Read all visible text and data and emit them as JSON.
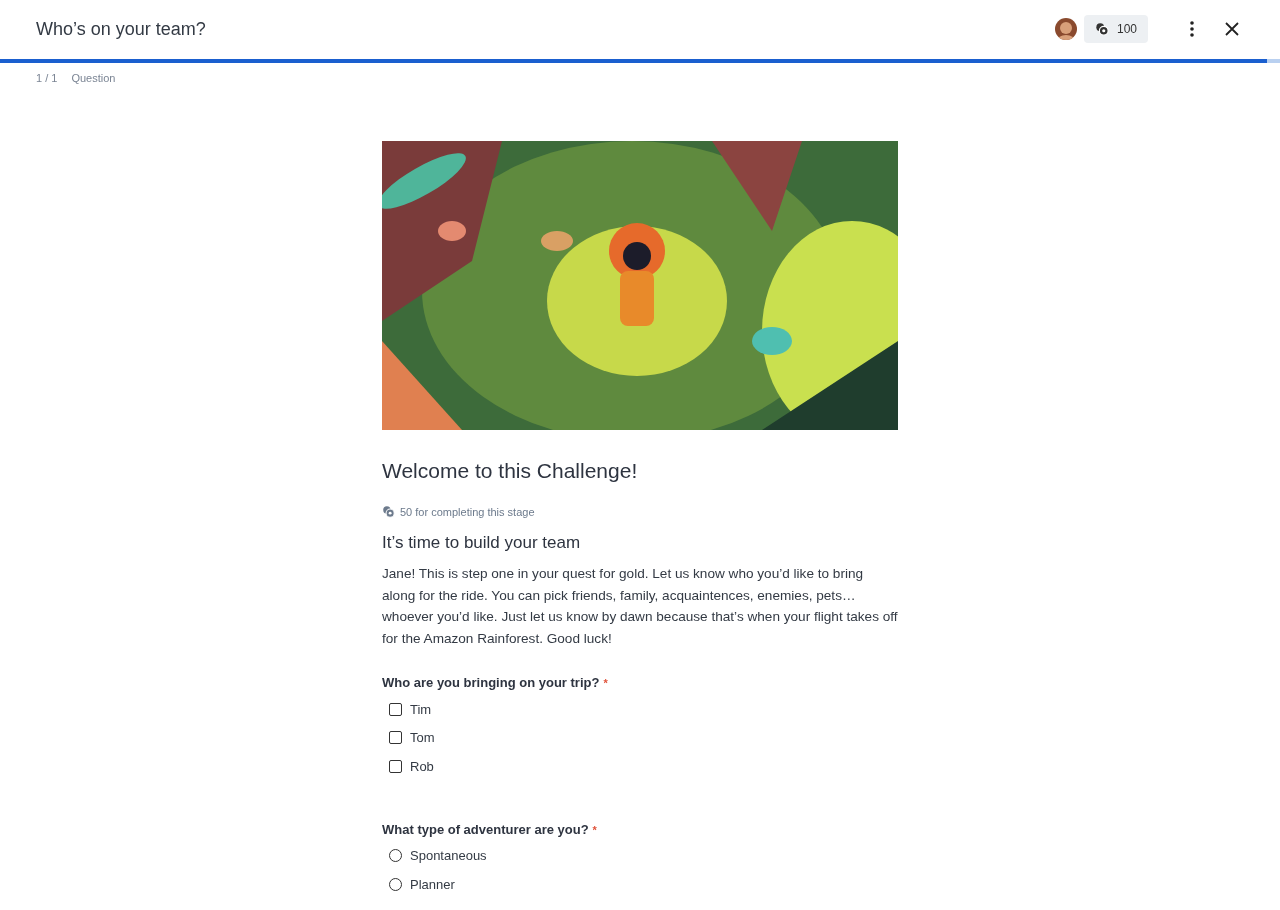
{
  "header": {
    "title": "Who’s on your team?",
    "points": "100"
  },
  "progress": {
    "level": 0.99
  },
  "breadcrumb": {
    "count": "1 / 1",
    "label": "Question"
  },
  "content": {
    "title": "Welcome to this Challenge!",
    "reward": "50 for completing this stage",
    "subtitle": "It’s time to build your team",
    "body": "Jane! This is step one in your quest for gold. Let us know who you’d like to bring along for the ride. You can pick friends, family, acquaintences, enemies, pets… whoever you’d like. Just let us know by dawn because that’s when your flight takes off for the Amazon Rainforest. Good luck!"
  },
  "questions": [
    {
      "kind": "checkbox",
      "label": "Who are you bringing on your trip?",
      "required_mark": "*",
      "options": [
        {
          "label": "Tim",
          "checked": false
        },
        {
          "label": "Tom",
          "checked": false
        },
        {
          "label": "Rob",
          "checked": false
        }
      ]
    },
    {
      "kind": "radio",
      "label": "What type of adventurer are you?",
      "required_mark": "*",
      "options": [
        {
          "label": "Spontaneous",
          "checked": false
        },
        {
          "label": "Planner",
          "checked": false
        }
      ]
    }
  ]
}
